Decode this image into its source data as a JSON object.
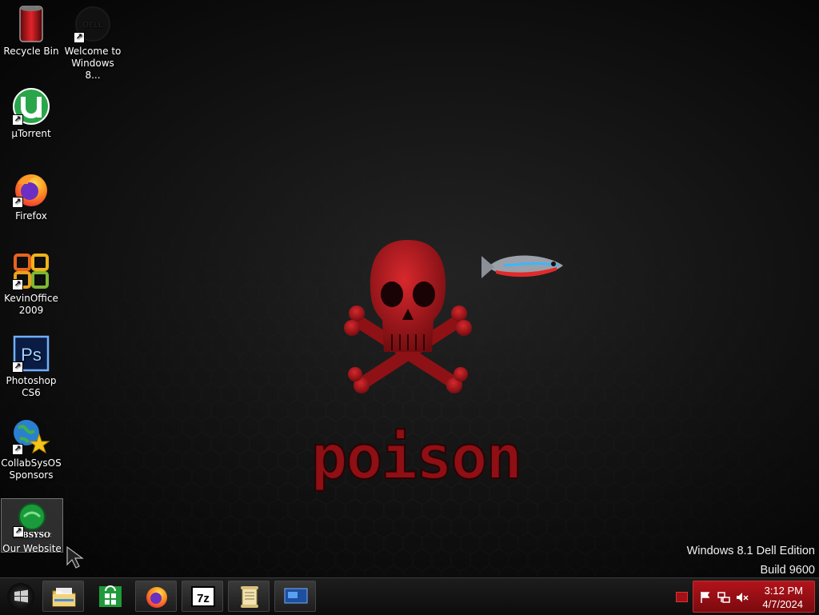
{
  "desktop": {
    "icons": [
      {
        "label": "Recycle Bin",
        "icon": "recycle-bin-icon"
      },
      {
        "label": "Welcome to Windows 8...",
        "icon": "dell-logo-icon"
      },
      {
        "label": "µTorrent",
        "icon": "utorrent-icon"
      },
      {
        "label": "Firefox",
        "icon": "firefox-icon"
      },
      {
        "label": "KevinOffice 2009",
        "icon": "office-icon"
      },
      {
        "label": "Photoshop CS6",
        "icon": "photoshop-icon"
      },
      {
        "label": "CollabSysOS Sponsors",
        "icon": "globe-star-icon"
      },
      {
        "label": "Our Website",
        "icon": "collabsysos-website-icon",
        "badge": "LABSYSOS"
      }
    ],
    "photoshop_text": "Ps",
    "wallpaper_text": "poison",
    "watermark": {
      "line1": "Windows 8.1 Dell Edition",
      "line2": "Build 9600"
    }
  },
  "taskbar": {
    "pinned": [
      "file-explorer-icon",
      "store-icon",
      "firefox-icon",
      "7zip-icon",
      "notepad-scroll-icon",
      "remote-desktop-icon"
    ],
    "sevenzip_text": "7z",
    "clock": {
      "time": "3:12 PM",
      "date": "4/7/2024"
    }
  },
  "colors": {
    "accent": "#b3131a",
    "skull": "#b01a1f"
  }
}
